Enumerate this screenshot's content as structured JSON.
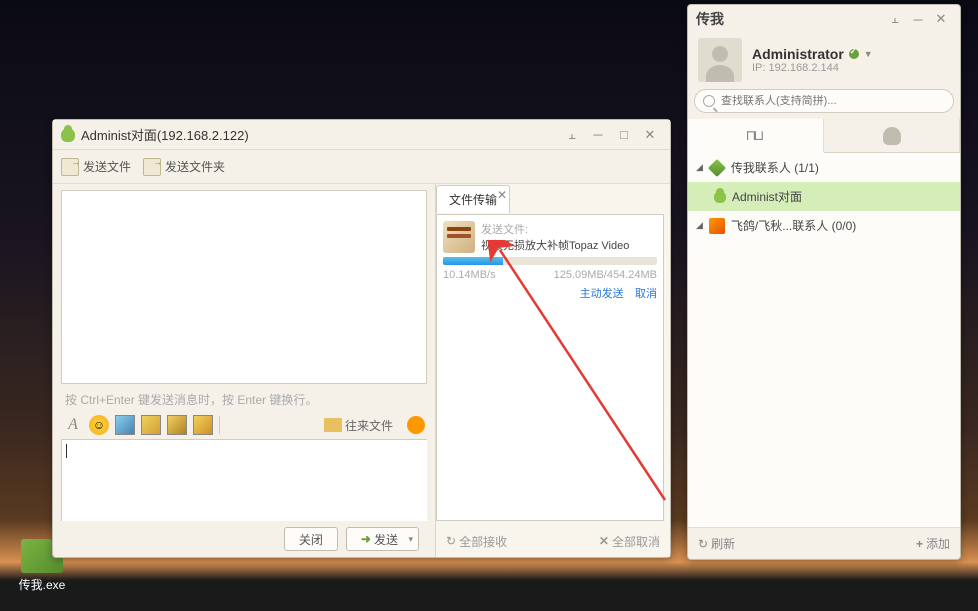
{
  "desktop": {
    "icon_label": "传我.exe"
  },
  "chat": {
    "title": "Administ对面(192.168.2.122)",
    "toolbar": {
      "send_file": "发送文件",
      "send_folder": "发送文件夹"
    },
    "hint": "按 Ctrl+Enter 键发送消息时，按 Enter 键换行。",
    "past_files": "往来文件",
    "close_btn": "关闭",
    "send_btn": "发送",
    "transfer": {
      "tab_label": "文件传输",
      "send_label": "发送文件:",
      "file_name": "视频无损放大补帧Topaz Video",
      "speed": "10.14MB/s",
      "progress_text": "125.09MB/454.24MB",
      "action_active": "主动发送",
      "action_cancel": "取消"
    },
    "footer": {
      "accept_all": "全部接收",
      "cancel_all": "全部取消"
    }
  },
  "main": {
    "app_title": "传我",
    "username": "Administrator",
    "ip": "IP: 192.168.2.144",
    "search_placeholder": "查找联系人(支持简拼)...",
    "groups": [
      {
        "label": "传我联系人 (1/1)"
      },
      {
        "label": "飞鸽/飞秋...联系人 (0/0)"
      }
    ],
    "contact": "Administ对面",
    "footer": {
      "refresh": "刷新",
      "add": "添加"
    }
  }
}
